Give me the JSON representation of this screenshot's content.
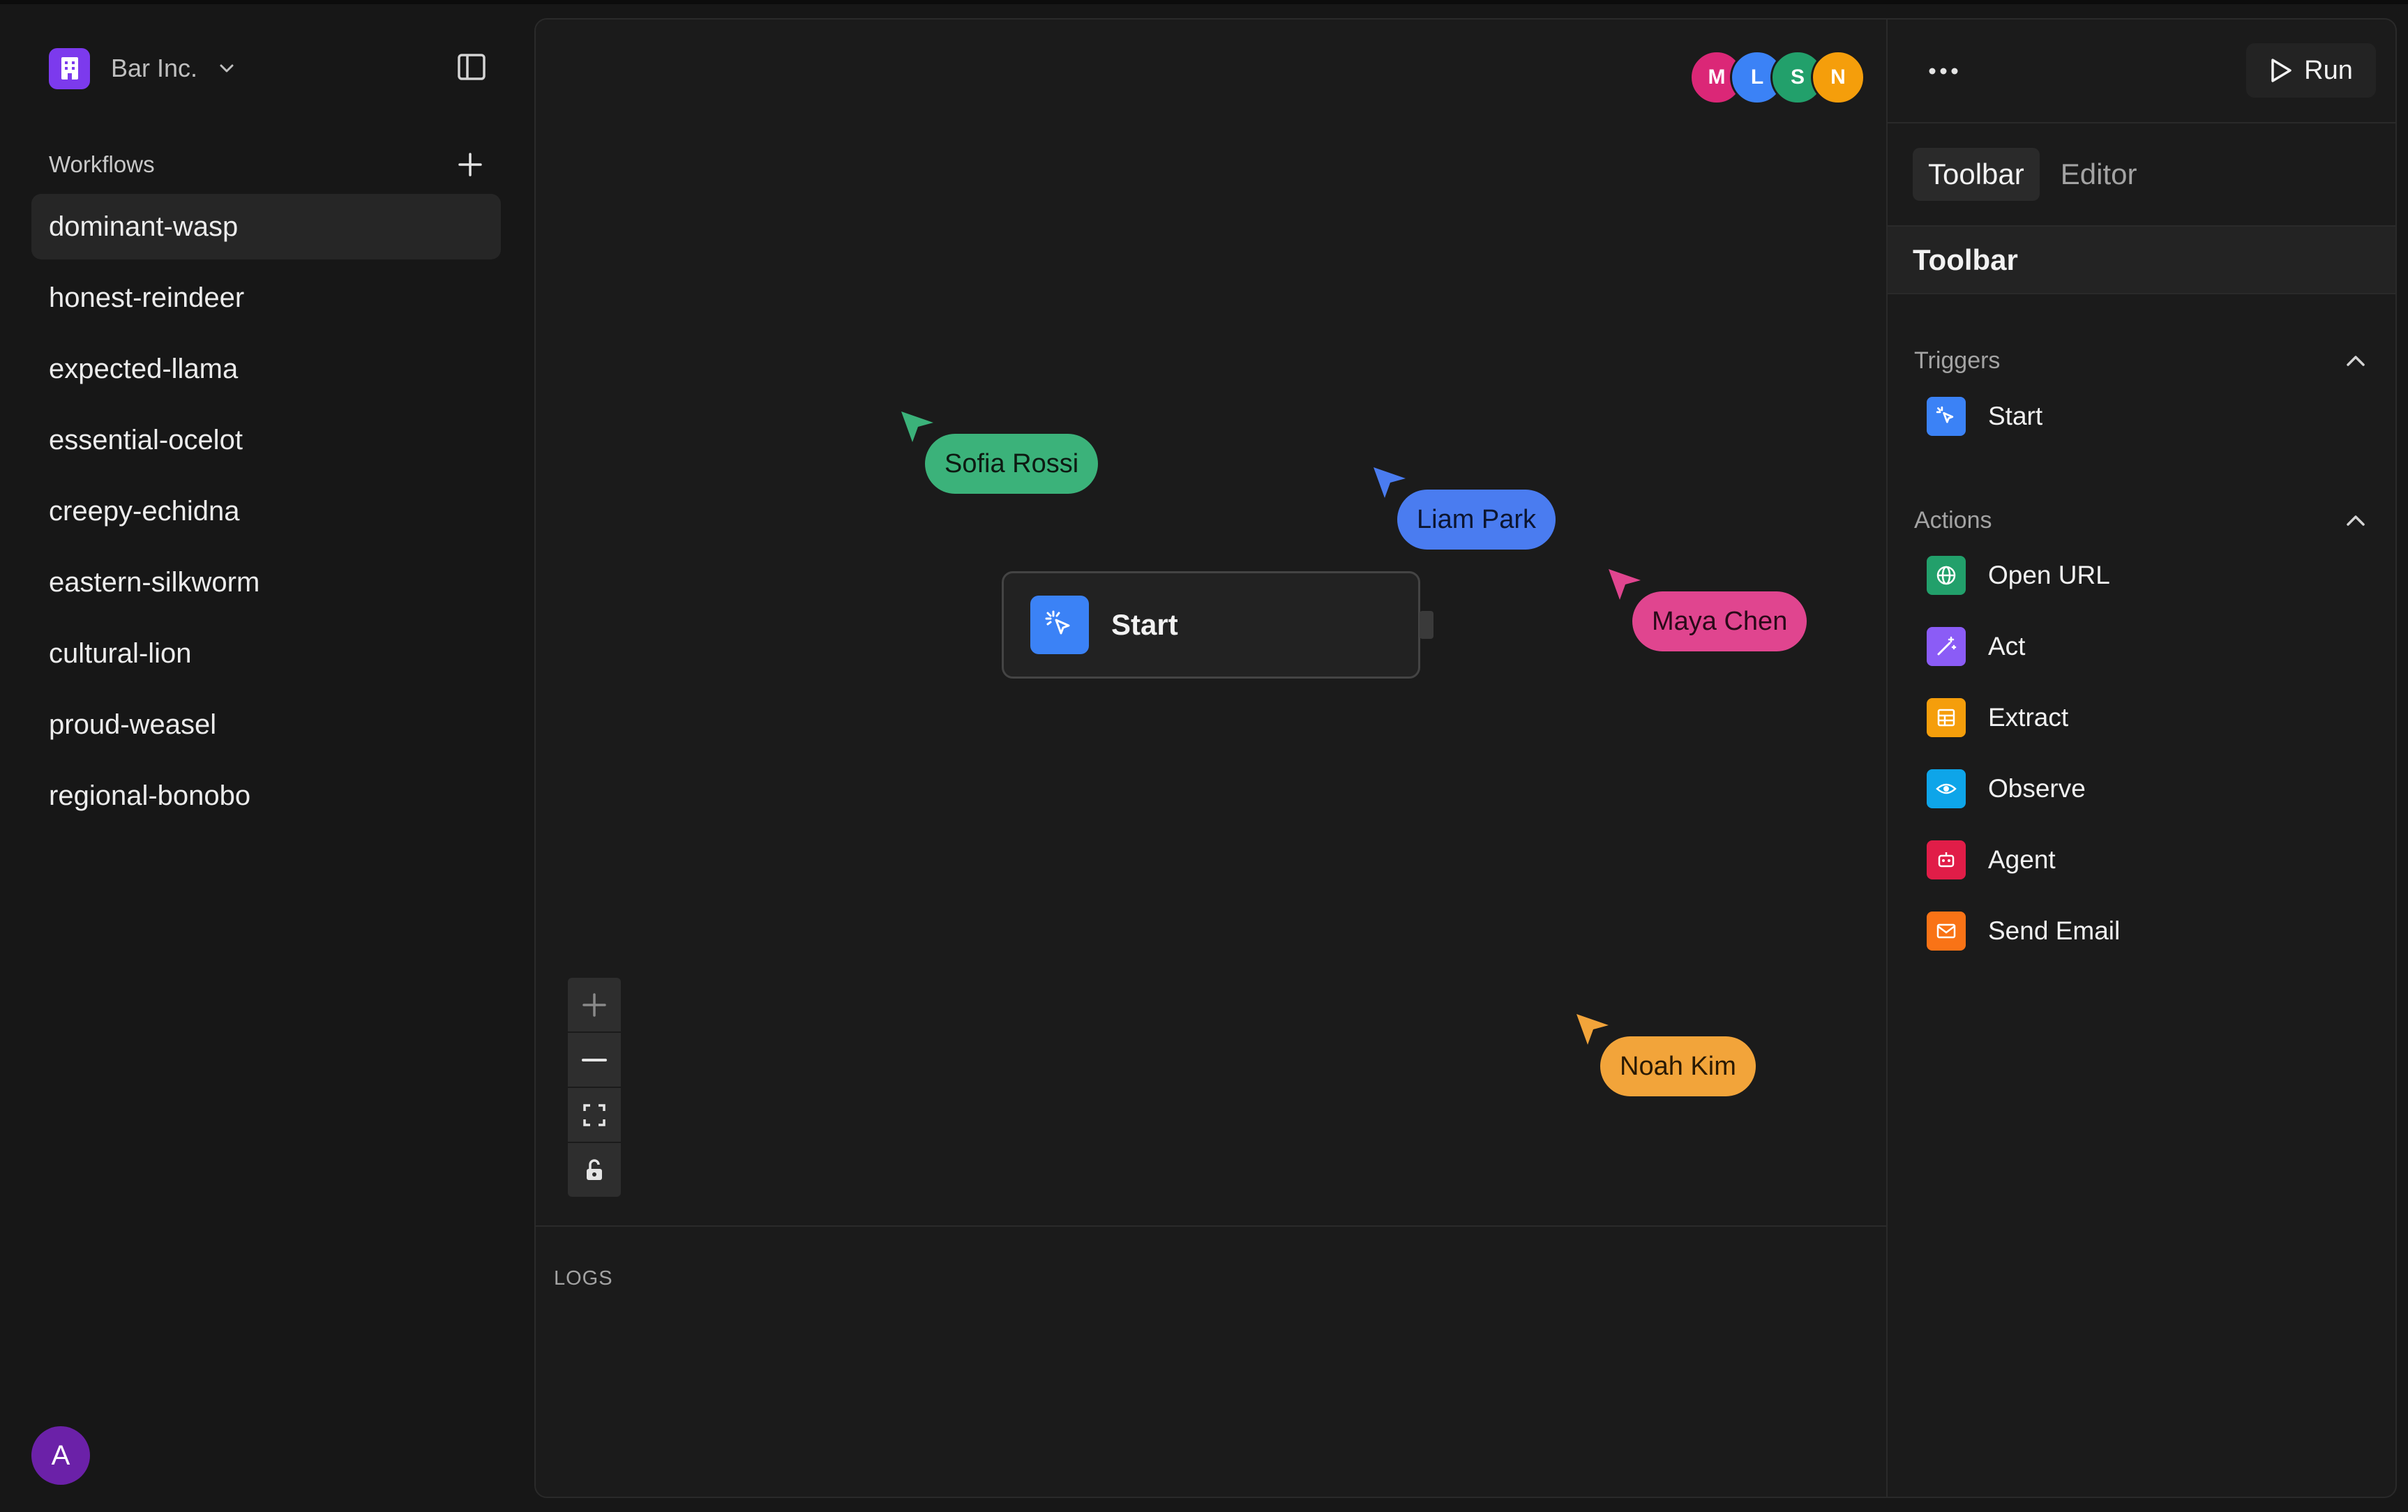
{
  "org": {
    "name": "Bar Inc."
  },
  "sidebar": {
    "section_title": "Workflows",
    "items": [
      {
        "label": "dominant-wasp"
      },
      {
        "label": "honest-reindeer"
      },
      {
        "label": "expected-llama"
      },
      {
        "label": "essential-ocelot"
      },
      {
        "label": "creepy-echidna"
      },
      {
        "label": "eastern-silkworm"
      },
      {
        "label": "cultural-lion"
      },
      {
        "label": "proud-weasel"
      },
      {
        "label": "regional-bonobo"
      }
    ],
    "active_item": "dominant-wasp",
    "user_initial": "A"
  },
  "presence": [
    {
      "initial": "M",
      "color": "#db2777"
    },
    {
      "initial": "L",
      "color": "#3b82f6"
    },
    {
      "initial": "S",
      "color": "#22a06b"
    },
    {
      "initial": "N",
      "color": "#f59e0b"
    }
  ],
  "canvas": {
    "node": {
      "label": "Start",
      "icon": "pointer-click-icon"
    },
    "cursors": [
      {
        "name": "Sofia Rossi",
        "color": "#3bb27a"
      },
      {
        "name": "Liam Park",
        "color": "#4a7cf0"
      },
      {
        "name": "Maya Chen",
        "color": "#e0458f"
      },
      {
        "name": "Noah Kim",
        "color": "#f2a43a"
      }
    ],
    "zoom_controls": [
      "zoom-in-icon",
      "zoom-out-icon",
      "fit-view-icon",
      "lock-icon"
    ]
  },
  "logs": {
    "title": "LOGS"
  },
  "right_panel": {
    "run_label": "Run",
    "tabs": [
      {
        "label": "Toolbar"
      },
      {
        "label": "Editor"
      }
    ],
    "active_tab": "Toolbar",
    "section_title": "Toolbar",
    "triggers": {
      "title": "Triggers",
      "items": [
        {
          "label": "Start",
          "icon": "pointer-click-icon",
          "color": "#3b82f6"
        }
      ]
    },
    "actions": {
      "title": "Actions",
      "items": [
        {
          "label": "Open URL",
          "icon": "globe-icon",
          "color": "#22a06b"
        },
        {
          "label": "Act",
          "icon": "magic-wand-icon",
          "color": "#8b5cf6"
        },
        {
          "label": "Extract",
          "icon": "table-icon",
          "color": "#f59e0b"
        },
        {
          "label": "Observe",
          "icon": "eye-icon",
          "color": "#0ea5e9"
        },
        {
          "label": "Agent",
          "icon": "robot-icon",
          "color": "#e11d48"
        },
        {
          "label": "Send Email",
          "icon": "mail-icon",
          "color": "#f97316"
        }
      ]
    }
  }
}
